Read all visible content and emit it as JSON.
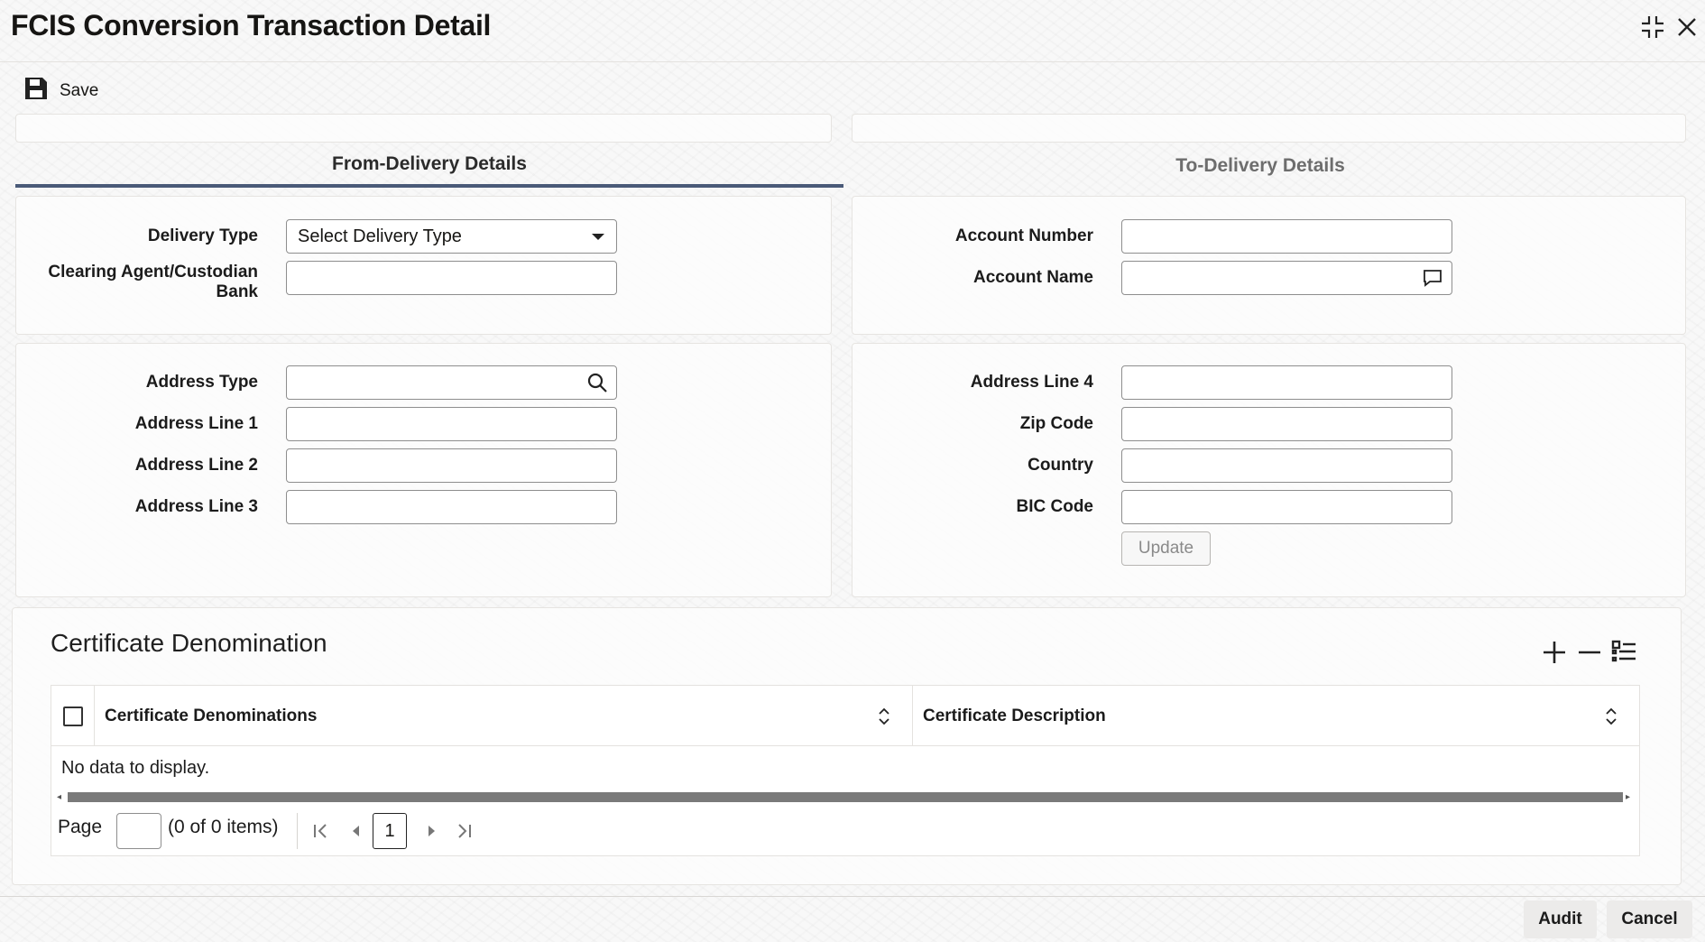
{
  "window": {
    "title": "FCIS Conversion Transaction Detail"
  },
  "toolbar": {
    "save_label": "Save"
  },
  "tabs": [
    {
      "label": "From-Delivery Details",
      "active": true
    },
    {
      "label": "To-Delivery Details",
      "active": false
    }
  ],
  "from_delivery": {
    "delivery_type_label": "Delivery Type",
    "delivery_type_value": "Select Delivery Type",
    "clearing_agent_label_line1": "Clearing Agent/Custodian",
    "clearing_agent_label_line2": "Bank",
    "clearing_agent_value": "",
    "address_type_label": "Address Type",
    "address_type_value": "",
    "address_line1_label": "Address Line 1",
    "address_line1_value": "",
    "address_line2_label": "Address Line 2",
    "address_line2_value": "",
    "address_line3_label": "Address Line 3",
    "address_line3_value": ""
  },
  "to_delivery": {
    "account_number_label": "Account Number",
    "account_number_value": "",
    "account_name_label": "Account Name",
    "account_name_value": "",
    "address_line4_label": "Address Line 4",
    "address_line4_value": "",
    "zip_code_label": "Zip Code",
    "zip_code_value": "",
    "country_label": "Country",
    "country_value": "",
    "bic_code_label": "BIC Code",
    "bic_code_value": "",
    "update_label": "Update"
  },
  "certificate": {
    "title": "Certificate Denomination",
    "columns": [
      "Certificate Denominations",
      "Certificate Description"
    ],
    "empty_text": "No data to display.",
    "page_label": "Page",
    "page_input": "",
    "items_text": "(0 of 0 items)",
    "current_page": "1"
  },
  "footer": {
    "audit_label": "Audit",
    "cancel_label": "Cancel"
  },
  "colors": {
    "active_tab_underline": "#4a5a78",
    "scrollbar": "#7a7a7a"
  }
}
